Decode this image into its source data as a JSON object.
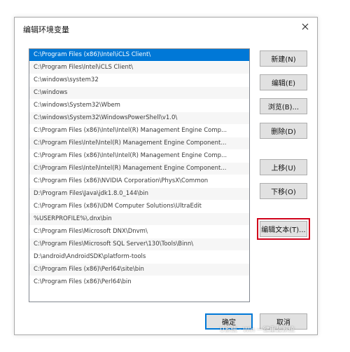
{
  "dialog": {
    "title": "编辑环境变量"
  },
  "paths": [
    "C:\\Program Files (x86)\\Intel\\iCLS Client\\",
    "C:\\Program Files\\Intel\\iCLS Client\\",
    "C:\\windows\\system32",
    "C:\\windows",
    "C:\\windows\\System32\\Wbem",
    "C:\\windows\\System32\\WindowsPowerShell\\v1.0\\",
    "C:\\Program Files (x86)\\Intel\\Intel(R) Management Engine Comp...",
    "C:\\Program Files\\Intel\\Intel(R) Management Engine Component...",
    "C:\\Program Files (x86)\\Intel\\Intel(R) Management Engine Comp...",
    "C:\\Program Files\\Intel\\Intel(R) Management Engine Component...",
    "C:\\Program Files (x86)\\NVIDIA Corporation\\PhysX\\Common",
    "D:\\Program Files\\Java\\jdk1.8.0_144\\bin",
    "C:\\Program Files (x86)\\IDM Computer Solutions\\UltraEdit",
    "%USERPROFILE%\\.dnx\\bin",
    "C:\\Program Files\\Microsoft DNX\\Dnvm\\",
    "C:\\Program Files\\Microsoft SQL Server\\130\\Tools\\Binn\\",
    "D:\\android\\AndroidSDK\\platform-tools",
    "C:\\Program Files (x86)\\Perl64\\site\\bin",
    "C:\\Program Files (x86)\\Perl64\\bin"
  ],
  "selected_index": 0,
  "buttons": {
    "new": "新建(N)",
    "edit": "编辑(E)",
    "browse": "浏览(B)...",
    "delete": "删除(D)",
    "move_up": "上移(U)",
    "move_down": "下移(O)",
    "edit_text": "编辑文本(T)...",
    "ok": "确定",
    "cancel": "取消"
  },
  "watermark": "U系统 · Win 一键重装系统",
  "colors": {
    "selection": "#0078d7",
    "highlight_box": "#d0021b"
  },
  "icons": {
    "close": "close-icon"
  }
}
